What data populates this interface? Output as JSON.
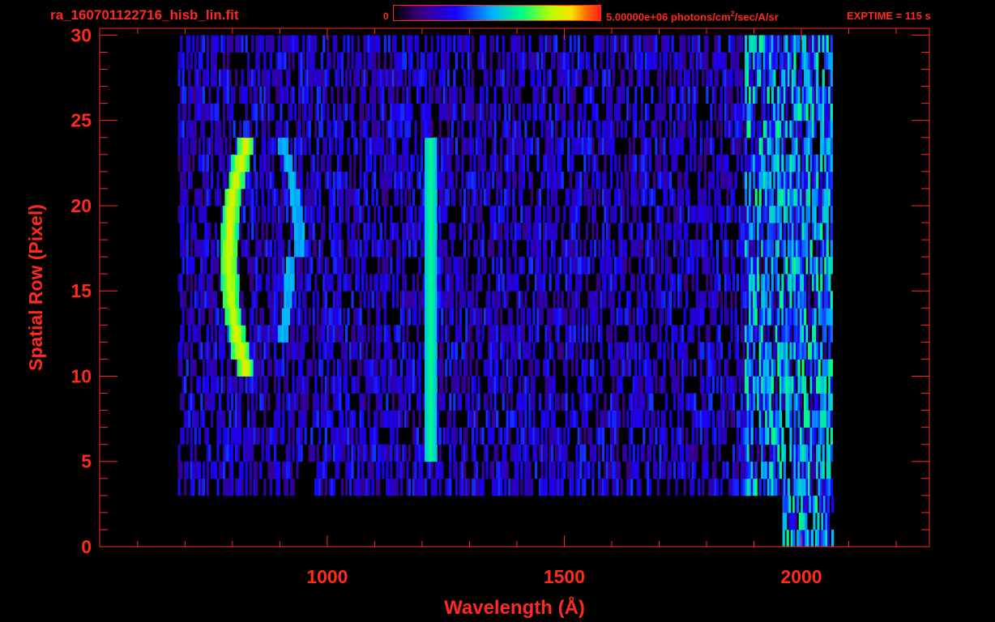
{
  "header": {
    "filename": "ra_160701122716_hisb_lin.fit",
    "colorbar_min": "0",
    "colorbar_max_prefix": "5.00000e+06 photons/cm",
    "colorbar_max_sup": "2",
    "colorbar_max_suffix": "/sec/A/sr",
    "exptime": "EXPTIME = 115 s"
  },
  "colors": {
    "axis": "#ff2a1a",
    "background": "#000000"
  },
  "chart_data": {
    "type": "heatmap",
    "title": "",
    "xlabel": "Wavelength (Å)",
    "ylabel": "Spatial Row (Pixel)",
    "xlim": [
      520,
      2270
    ],
    "ylim": [
      0,
      30.4
    ],
    "x_ticks": [
      1000,
      1500,
      2000
    ],
    "x_tick_labels": [
      "1000",
      "1500",
      "2000"
    ],
    "y_ticks": [
      0,
      5,
      10,
      15,
      20,
      25,
      30
    ],
    "y_tick_labels": [
      "0",
      "5",
      "10",
      "15",
      "20",
      "25",
      "30"
    ],
    "colorscale": "rainbow (black-purple-blue-cyan-green-yellow-red)",
    "colorbar_range": [
      0,
      5000000
    ],
    "features": [
      {
        "name": "emission arc",
        "x_range": [
          780,
          980
        ],
        "y_range": [
          10,
          24
        ],
        "peak_intensity": 0.85
      },
      {
        "name": "Lyman-alpha line",
        "x_center": 1216,
        "y_range": [
          5,
          24
        ],
        "peak_intensity": 0.65
      },
      {
        "name": "long-wavelength edge",
        "x_range": [
          1900,
          2070
        ],
        "y_range": [
          1,
          30
        ],
        "peak_intensity": 0.6
      }
    ]
  }
}
